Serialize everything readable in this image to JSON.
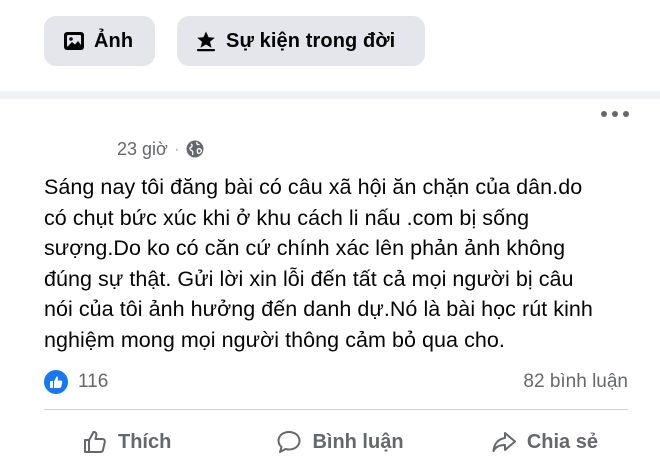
{
  "composer": {
    "photo_label": "Ảnh",
    "life_event_label": "Sự kiện trong đời"
  },
  "post": {
    "timestamp": "23 giờ",
    "separator": "·",
    "privacy_icon": "globe-icon",
    "more_icon": "more-options-icon",
    "text": "Sáng nay tôi đăng bài có câu xã hội ăn chặn của dân.do\ncó chụt bức xúc khi ở khu cách li nấu .com bị sống\nsượng.Do ko có căn cứ chính  xác lên phản ảnh không\nđúng sự thật. Gửi lời xin lỗi đến tất cả mọi người bị câu\nnói của tôi ảnh hưởng đến danh dự.Nó là bài học rút kinh\nnghiệm  mong mọi người thông cảm bỏ qua cho.",
    "reaction_count": "116",
    "comment_count": "82 bình luận"
  },
  "actions": {
    "like_label": "Thích",
    "comment_label": "Bình luận",
    "share_label": "Chia sẻ"
  },
  "colors": {
    "chip_bg": "#e4e6eb",
    "accent_blue": "#1877f2",
    "secondary_text": "#65676b",
    "primary_text": "#050505"
  }
}
